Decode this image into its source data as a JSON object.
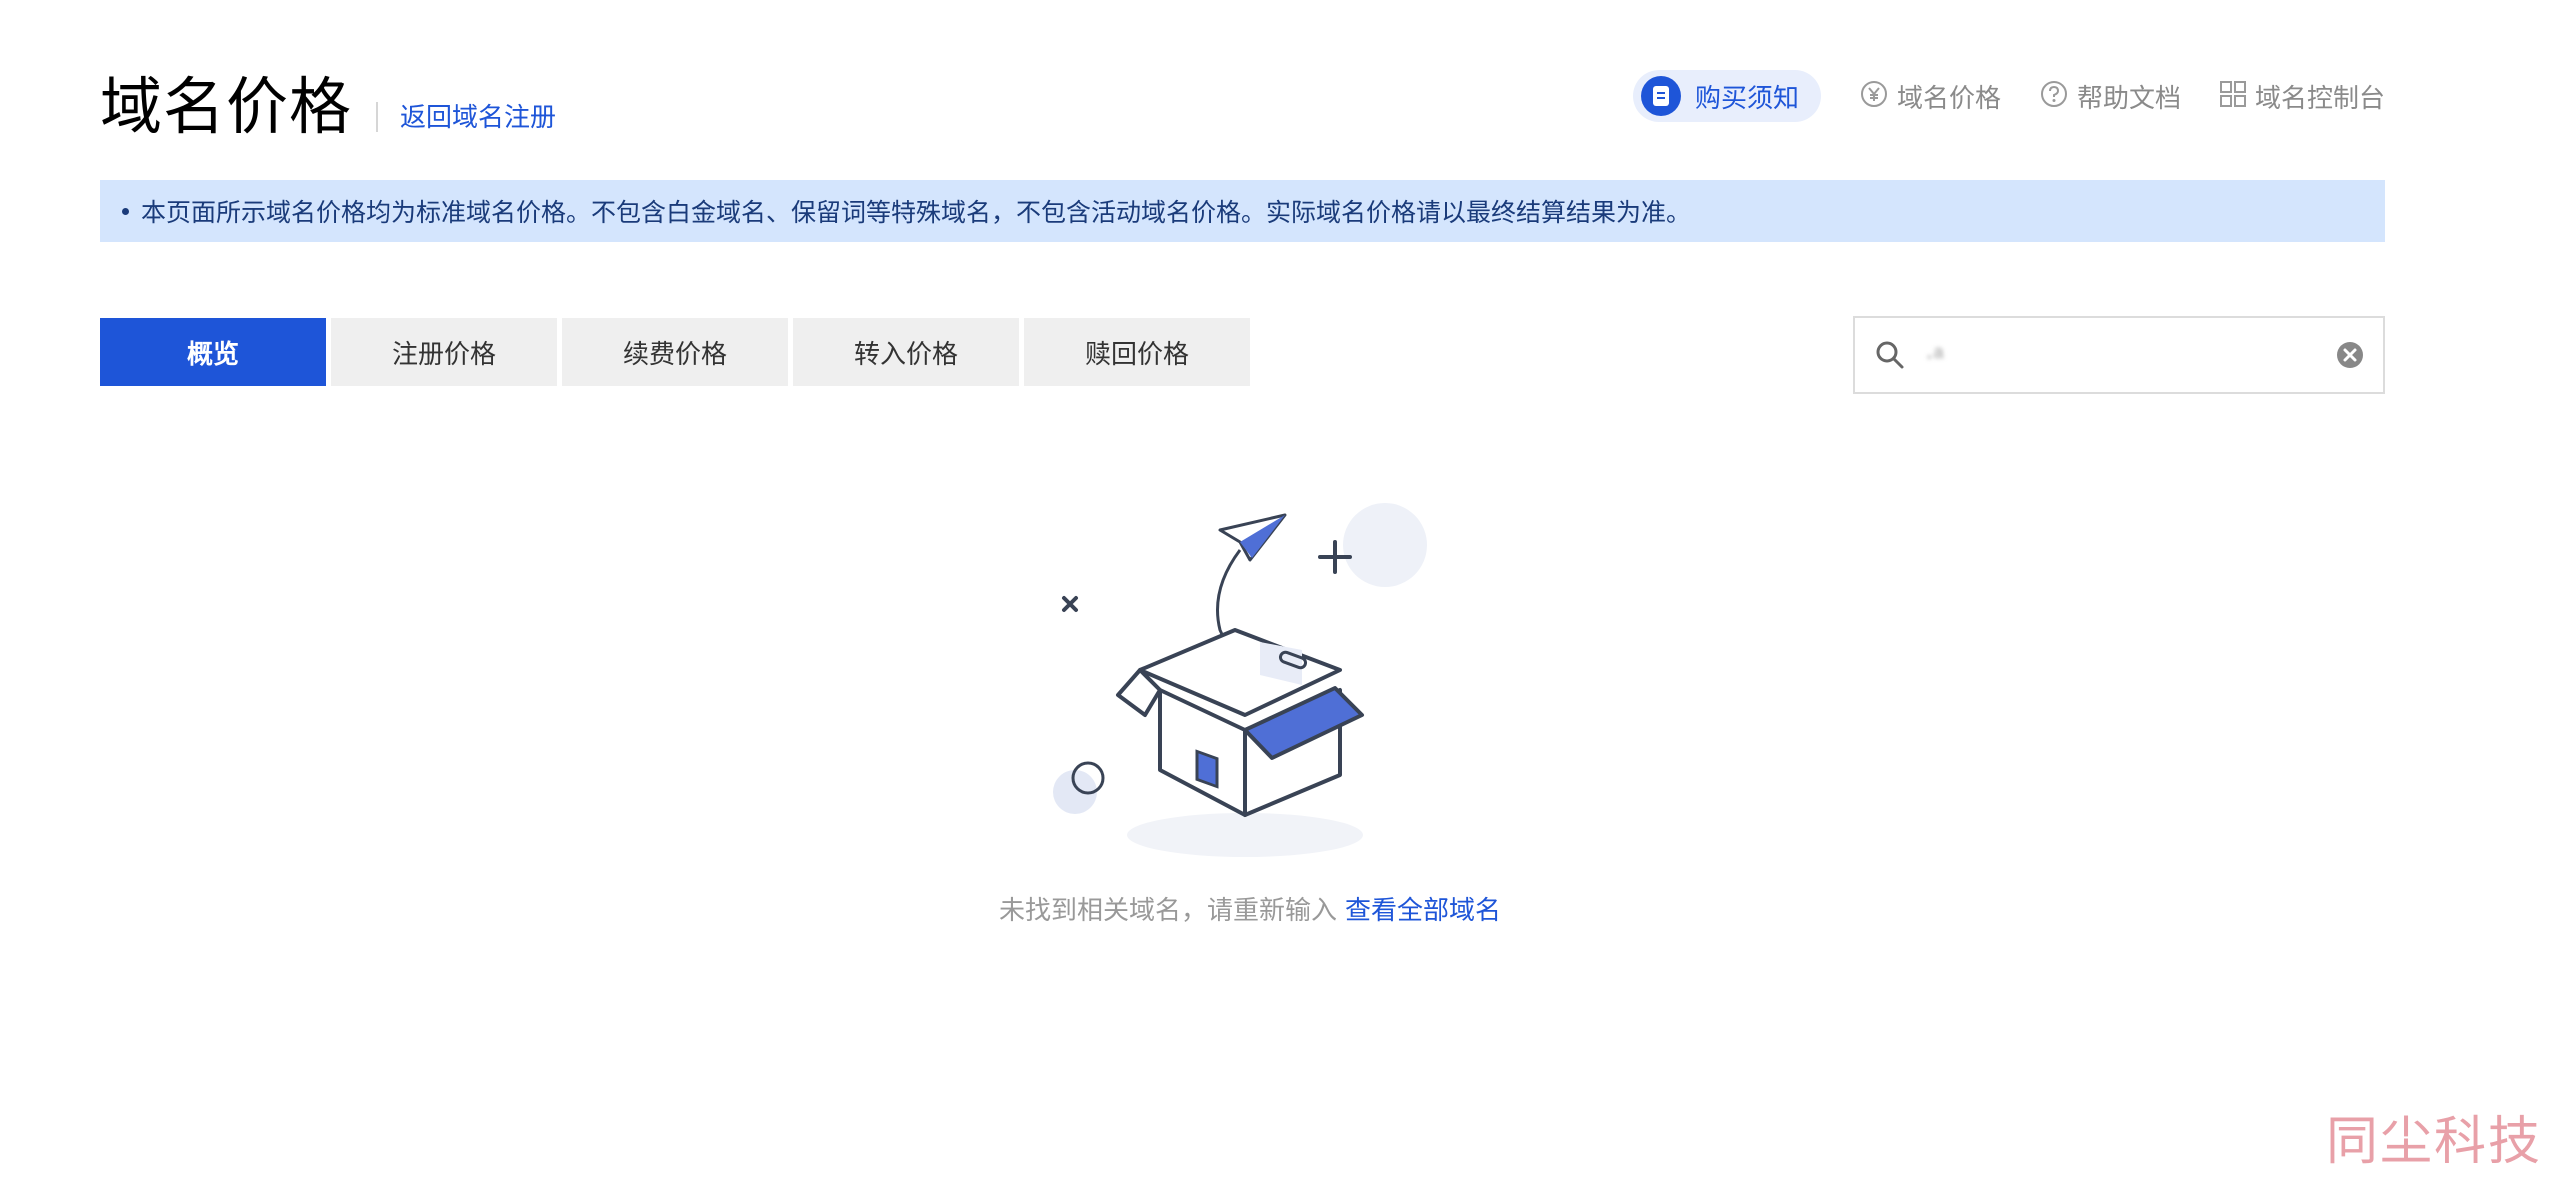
{
  "header": {
    "title": "域名价格",
    "back_link": "返回域名注册"
  },
  "top_links": {
    "notice": "购买须知",
    "price": "域名价格",
    "help": "帮助文档",
    "console": "域名控制台"
  },
  "notice_bar": {
    "text": "本页面所示域名价格均为标准域名价格。不包含白金域名、保留词等特殊域名，不包含活动域名价格。实际域名价格请以最终结算结果为准。"
  },
  "tabs": [
    {
      "label": "概览",
      "active": true
    },
    {
      "label": "注册价格",
      "active": false
    },
    {
      "label": "续费价格",
      "active": false
    },
    {
      "label": "转入价格",
      "active": false
    },
    {
      "label": "赎回价格",
      "active": false
    }
  ],
  "search": {
    "value": "·ᵃ",
    "icons": [
      "search-icon",
      "clear-icon"
    ]
  },
  "empty_state": {
    "message": "未找到相关域名，请重新输入",
    "link": "查看全部域名"
  },
  "watermark": "同尘科技",
  "colors": {
    "accent": "#1e55d8",
    "notice_bg": "#d4e5fd",
    "tab_bg": "#efefef"
  }
}
